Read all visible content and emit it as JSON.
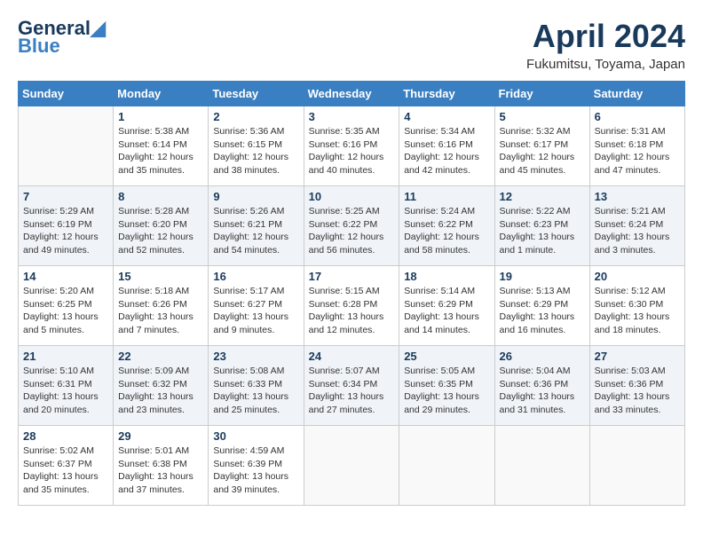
{
  "header": {
    "logo_line1": "General",
    "logo_line2": "Blue",
    "month_title": "April 2024",
    "subtitle": "Fukumitsu, Toyama, Japan"
  },
  "days_of_week": [
    "Sunday",
    "Monday",
    "Tuesday",
    "Wednesday",
    "Thursday",
    "Friday",
    "Saturday"
  ],
  "weeks": [
    [
      {
        "day": "",
        "info": ""
      },
      {
        "day": "1",
        "info": "Sunrise: 5:38 AM\nSunset: 6:14 PM\nDaylight: 12 hours\nand 35 minutes."
      },
      {
        "day": "2",
        "info": "Sunrise: 5:36 AM\nSunset: 6:15 PM\nDaylight: 12 hours\nand 38 minutes."
      },
      {
        "day": "3",
        "info": "Sunrise: 5:35 AM\nSunset: 6:16 PM\nDaylight: 12 hours\nand 40 minutes."
      },
      {
        "day": "4",
        "info": "Sunrise: 5:34 AM\nSunset: 6:16 PM\nDaylight: 12 hours\nand 42 minutes."
      },
      {
        "day": "5",
        "info": "Sunrise: 5:32 AM\nSunset: 6:17 PM\nDaylight: 12 hours\nand 45 minutes."
      },
      {
        "day": "6",
        "info": "Sunrise: 5:31 AM\nSunset: 6:18 PM\nDaylight: 12 hours\nand 47 minutes."
      }
    ],
    [
      {
        "day": "7",
        "info": "Sunrise: 5:29 AM\nSunset: 6:19 PM\nDaylight: 12 hours\nand 49 minutes."
      },
      {
        "day": "8",
        "info": "Sunrise: 5:28 AM\nSunset: 6:20 PM\nDaylight: 12 hours\nand 52 minutes."
      },
      {
        "day": "9",
        "info": "Sunrise: 5:26 AM\nSunset: 6:21 PM\nDaylight: 12 hours\nand 54 minutes."
      },
      {
        "day": "10",
        "info": "Sunrise: 5:25 AM\nSunset: 6:22 PM\nDaylight: 12 hours\nand 56 minutes."
      },
      {
        "day": "11",
        "info": "Sunrise: 5:24 AM\nSunset: 6:22 PM\nDaylight: 12 hours\nand 58 minutes."
      },
      {
        "day": "12",
        "info": "Sunrise: 5:22 AM\nSunset: 6:23 PM\nDaylight: 13 hours\nand 1 minute."
      },
      {
        "day": "13",
        "info": "Sunrise: 5:21 AM\nSunset: 6:24 PM\nDaylight: 13 hours\nand 3 minutes."
      }
    ],
    [
      {
        "day": "14",
        "info": "Sunrise: 5:20 AM\nSunset: 6:25 PM\nDaylight: 13 hours\nand 5 minutes."
      },
      {
        "day": "15",
        "info": "Sunrise: 5:18 AM\nSunset: 6:26 PM\nDaylight: 13 hours\nand 7 minutes."
      },
      {
        "day": "16",
        "info": "Sunrise: 5:17 AM\nSunset: 6:27 PM\nDaylight: 13 hours\nand 9 minutes."
      },
      {
        "day": "17",
        "info": "Sunrise: 5:15 AM\nSunset: 6:28 PM\nDaylight: 13 hours\nand 12 minutes."
      },
      {
        "day": "18",
        "info": "Sunrise: 5:14 AM\nSunset: 6:29 PM\nDaylight: 13 hours\nand 14 minutes."
      },
      {
        "day": "19",
        "info": "Sunrise: 5:13 AM\nSunset: 6:29 PM\nDaylight: 13 hours\nand 16 minutes."
      },
      {
        "day": "20",
        "info": "Sunrise: 5:12 AM\nSunset: 6:30 PM\nDaylight: 13 hours\nand 18 minutes."
      }
    ],
    [
      {
        "day": "21",
        "info": "Sunrise: 5:10 AM\nSunset: 6:31 PM\nDaylight: 13 hours\nand 20 minutes."
      },
      {
        "day": "22",
        "info": "Sunrise: 5:09 AM\nSunset: 6:32 PM\nDaylight: 13 hours\nand 23 minutes."
      },
      {
        "day": "23",
        "info": "Sunrise: 5:08 AM\nSunset: 6:33 PM\nDaylight: 13 hours\nand 25 minutes."
      },
      {
        "day": "24",
        "info": "Sunrise: 5:07 AM\nSunset: 6:34 PM\nDaylight: 13 hours\nand 27 minutes."
      },
      {
        "day": "25",
        "info": "Sunrise: 5:05 AM\nSunset: 6:35 PM\nDaylight: 13 hours\nand 29 minutes."
      },
      {
        "day": "26",
        "info": "Sunrise: 5:04 AM\nSunset: 6:36 PM\nDaylight: 13 hours\nand 31 minutes."
      },
      {
        "day": "27",
        "info": "Sunrise: 5:03 AM\nSunset: 6:36 PM\nDaylight: 13 hours\nand 33 minutes."
      }
    ],
    [
      {
        "day": "28",
        "info": "Sunrise: 5:02 AM\nSunset: 6:37 PM\nDaylight: 13 hours\nand 35 minutes."
      },
      {
        "day": "29",
        "info": "Sunrise: 5:01 AM\nSunset: 6:38 PM\nDaylight: 13 hours\nand 37 minutes."
      },
      {
        "day": "30",
        "info": "Sunrise: 4:59 AM\nSunset: 6:39 PM\nDaylight: 13 hours\nand 39 minutes."
      },
      {
        "day": "",
        "info": ""
      },
      {
        "day": "",
        "info": ""
      },
      {
        "day": "",
        "info": ""
      },
      {
        "day": "",
        "info": ""
      }
    ]
  ]
}
